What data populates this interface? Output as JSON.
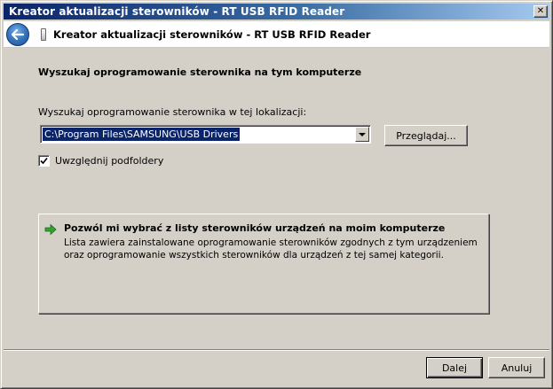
{
  "window": {
    "title": "Kreator aktualizacji sterowników - RT USB RFID Reader",
    "close_label": "✕"
  },
  "header": {
    "title": "Kreator aktualizacji sterowników - RT USB RFID Reader"
  },
  "main": {
    "heading": "Wyszukaj oprogramowanie sterownika na tym komputerze",
    "search_label": "Wyszukaj oprogramowanie sterownika w tej lokalizacji:",
    "location_value": "C:\\Program Files\\SAMSUNG\\USB Drivers",
    "browse_label": "Przeglądaj...",
    "include_subfolders_label": "Uwzględnij podfoldery",
    "include_subfolders_checked": true,
    "option": {
      "title": "Pozwól mi wybrać z listy sterowników urządzeń na moim komputerze",
      "description": "Lista zawiera zainstalowane oprogramowanie sterowników zgodnych z tym urządzeniem oraz oprogramowanie wszystkich sterowników dla urządzeń z tej samej kategorii."
    }
  },
  "footer": {
    "next_label": "Dalej",
    "cancel_label": "Anuluj"
  },
  "colors": {
    "titlebar_start": "#0a246a",
    "titlebar_end": "#a6caf0",
    "selection": "#0a246a",
    "arrow_green": "#2fa52f"
  }
}
